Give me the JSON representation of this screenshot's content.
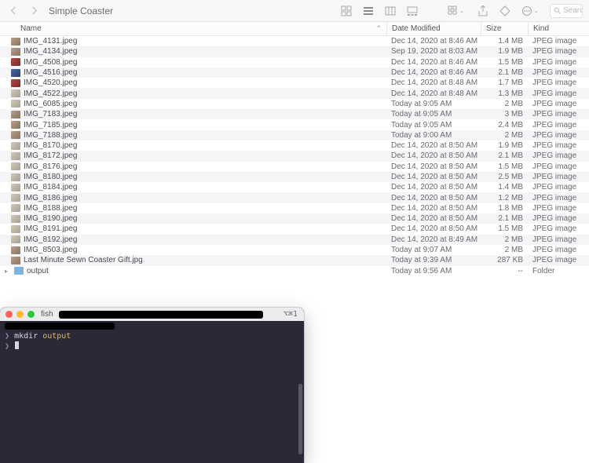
{
  "toolbar": {
    "title": "Simple Coaster",
    "search_placeholder": "Search"
  },
  "columns": {
    "name": "Name",
    "modified": "Date Modified",
    "size": "Size",
    "kind": "Kind"
  },
  "files": [
    {
      "name": "IMG_4131.jpeg",
      "mod": "Dec 14, 2020 at 8:46 AM",
      "size": "1.4 MB",
      "kind": "JPEG image",
      "tc": ""
    },
    {
      "name": "IMG_4134.jpeg",
      "mod": "Sep 19, 2020 at 8:03 AM",
      "size": "1.9 MB",
      "kind": "JPEG image",
      "tc": ""
    },
    {
      "name": "IMG_4508.jpeg",
      "mod": "Dec 14, 2020 at 8:46 AM",
      "size": "1.5 MB",
      "kind": "JPEG image",
      "tc": "v2"
    },
    {
      "name": "IMG_4516.jpeg",
      "mod": "Dec 14, 2020 at 8:46 AM",
      "size": "2.1 MB",
      "kind": "JPEG image",
      "tc": "v3"
    },
    {
      "name": "IMG_4520.jpeg",
      "mod": "Dec 14, 2020 at 8:48 AM",
      "size": "1.7 MB",
      "kind": "JPEG image",
      "tc": "v2"
    },
    {
      "name": "IMG_4522.jpeg",
      "mod": "Dec 14, 2020 at 8:48 AM",
      "size": "1.3 MB",
      "kind": "JPEG image",
      "tc": "v4"
    },
    {
      "name": "IMG_6085.jpeg",
      "mod": "Today at 9:05 AM",
      "size": "2 MB",
      "kind": "JPEG image",
      "tc": "v4"
    },
    {
      "name": "IMG_7183.jpeg",
      "mod": "Today at 9:05 AM",
      "size": "3 MB",
      "kind": "JPEG image",
      "tc": ""
    },
    {
      "name": "IMG_7185.jpeg",
      "mod": "Today at 9:05 AM",
      "size": "2.4 MB",
      "kind": "JPEG image",
      "tc": ""
    },
    {
      "name": "IMG_7188.jpeg",
      "mod": "Today at 9:00 AM",
      "size": "2 MB",
      "kind": "JPEG image",
      "tc": ""
    },
    {
      "name": "IMG_8170.jpeg",
      "mod": "Dec 14, 2020 at 8:50 AM",
      "size": "1.9 MB",
      "kind": "JPEG image",
      "tc": "v4"
    },
    {
      "name": "IMG_8172.jpeg",
      "mod": "Dec 14, 2020 at 8:50 AM",
      "size": "2.1 MB",
      "kind": "JPEG image",
      "tc": "v4"
    },
    {
      "name": "IMG_8176.jpeg",
      "mod": "Dec 14, 2020 at 8:50 AM",
      "size": "1.5 MB",
      "kind": "JPEG image",
      "tc": "v4"
    },
    {
      "name": "IMG_8180.jpeg",
      "mod": "Dec 14, 2020 at 8:50 AM",
      "size": "2.5 MB",
      "kind": "JPEG image",
      "tc": "v4"
    },
    {
      "name": "IMG_8184.jpeg",
      "mod": "Dec 14, 2020 at 8:50 AM",
      "size": "1.4 MB",
      "kind": "JPEG image",
      "tc": "v4"
    },
    {
      "name": "IMG_8186.jpeg",
      "mod": "Dec 14, 2020 at 8:50 AM",
      "size": "1.2 MB",
      "kind": "JPEG image",
      "tc": "v4"
    },
    {
      "name": "IMG_8188.jpeg",
      "mod": "Dec 14, 2020 at 8:50 AM",
      "size": "1.8 MB",
      "kind": "JPEG image",
      "tc": "v4"
    },
    {
      "name": "IMG_8190.jpeg",
      "mod": "Dec 14, 2020 at 8:50 AM",
      "size": "2.1 MB",
      "kind": "JPEG image",
      "tc": "v4"
    },
    {
      "name": "IMG_8191.jpeg",
      "mod": "Dec 14, 2020 at 8:50 AM",
      "size": "1.5 MB",
      "kind": "JPEG image",
      "tc": "v4"
    },
    {
      "name": "IMG_8192.jpeg",
      "mod": "Dec 14, 2020 at 8:49 AM",
      "size": "2 MB",
      "kind": "JPEG image",
      "tc": "v4"
    },
    {
      "name": "IMG_8503.jpeg",
      "mod": "Today at 9:07 AM",
      "size": "2 MB",
      "kind": "JPEG image",
      "tc": ""
    },
    {
      "name": "Last Minute Sewn Coaster Gift.jpg",
      "mod": "Today at 9:39 AM",
      "size": "287 KB",
      "kind": "JPEG image",
      "tc": ""
    }
  ],
  "folder": {
    "name": "output",
    "mod": "Today at 9:56 AM",
    "size": "--",
    "kind": "Folder"
  },
  "terminal": {
    "shell": "fish",
    "tab_hint": "⌥⌘1",
    "prompt": "❯",
    "cmd": "mkdir",
    "arg": "output"
  }
}
